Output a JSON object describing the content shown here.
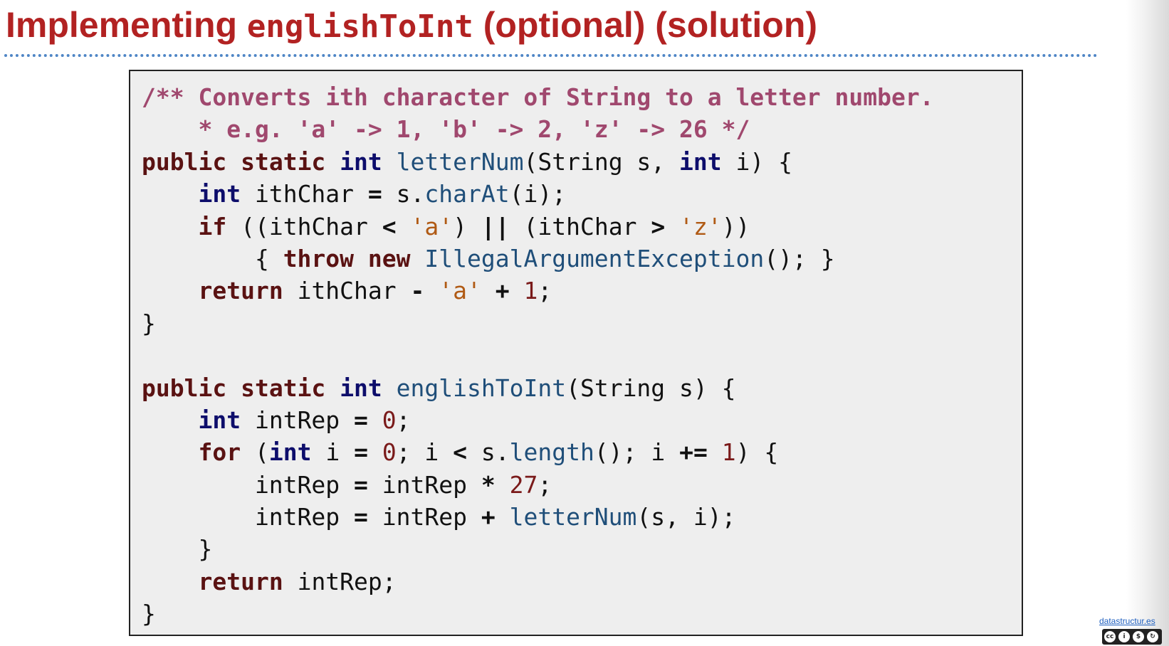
{
  "slide": {
    "title_prefix": "Implementing ",
    "title_code": "englishToInt",
    "title_suffix": " (optional) (solution)"
  },
  "code": {
    "lines": [
      [
        {
          "t": "/** Converts ith character of String to a letter number.",
          "c": "cm"
        }
      ],
      [
        {
          "t": "    * e.g. 'a' -> 1, 'b' -> 2, 'z' -> 26 */",
          "c": "cm"
        }
      ],
      [
        {
          "t": "public",
          "c": "kw"
        },
        {
          "t": " "
        },
        {
          "t": "static",
          "c": "kw"
        },
        {
          "t": " "
        },
        {
          "t": "int",
          "c": "ty"
        },
        {
          "t": " "
        },
        {
          "t": "letterNum",
          "c": "fn"
        },
        {
          "t": "(String s, "
        },
        {
          "t": "int",
          "c": "ty"
        },
        {
          "t": " i) {"
        }
      ],
      [
        {
          "t": "    "
        },
        {
          "t": "int",
          "c": "ty"
        },
        {
          "t": " ithChar "
        },
        {
          "t": "=",
          "c": "op"
        },
        {
          "t": " s."
        },
        {
          "t": "charAt",
          "c": "fn"
        },
        {
          "t": "(i);"
        }
      ],
      [
        {
          "t": "    "
        },
        {
          "t": "if",
          "c": "kw"
        },
        {
          "t": " ((ithChar "
        },
        {
          "t": "<",
          "c": "op"
        },
        {
          "t": " "
        },
        {
          "t": "'a'",
          "c": "st"
        },
        {
          "t": ") "
        },
        {
          "t": "||",
          "c": "op"
        },
        {
          "t": " (ithChar "
        },
        {
          "t": ">",
          "c": "op"
        },
        {
          "t": " "
        },
        {
          "t": "'z'",
          "c": "st"
        },
        {
          "t": "))"
        }
      ],
      [
        {
          "t": "        { "
        },
        {
          "t": "throw",
          "c": "kw"
        },
        {
          "t": " "
        },
        {
          "t": "new",
          "c": "kw"
        },
        {
          "t": " "
        },
        {
          "t": "IllegalArgumentException",
          "c": "fn"
        },
        {
          "t": "(); }"
        }
      ],
      [
        {
          "t": "    "
        },
        {
          "t": "return",
          "c": "kw"
        },
        {
          "t": " ithChar "
        },
        {
          "t": "-",
          "c": "op"
        },
        {
          "t": " "
        },
        {
          "t": "'a'",
          "c": "st"
        },
        {
          "t": " "
        },
        {
          "t": "+",
          "c": "op"
        },
        {
          "t": " "
        },
        {
          "t": "1",
          "c": "nu"
        },
        {
          "t": ";"
        }
      ],
      [
        {
          "t": "}"
        }
      ],
      [
        {
          "t": ""
        }
      ],
      [
        {
          "t": "public",
          "c": "kw"
        },
        {
          "t": " "
        },
        {
          "t": "static",
          "c": "kw"
        },
        {
          "t": " "
        },
        {
          "t": "int",
          "c": "ty"
        },
        {
          "t": " "
        },
        {
          "t": "englishToInt",
          "c": "fn"
        },
        {
          "t": "(String s) {"
        }
      ],
      [
        {
          "t": "    "
        },
        {
          "t": "int",
          "c": "ty"
        },
        {
          "t": " intRep "
        },
        {
          "t": "=",
          "c": "op"
        },
        {
          "t": " "
        },
        {
          "t": "0",
          "c": "nu"
        },
        {
          "t": ";"
        }
      ],
      [
        {
          "t": "    "
        },
        {
          "t": "for",
          "c": "kw"
        },
        {
          "t": " ("
        },
        {
          "t": "int",
          "c": "ty"
        },
        {
          "t": " i "
        },
        {
          "t": "=",
          "c": "op"
        },
        {
          "t": " "
        },
        {
          "t": "0",
          "c": "nu"
        },
        {
          "t": "; i "
        },
        {
          "t": "<",
          "c": "op"
        },
        {
          "t": " s."
        },
        {
          "t": "length",
          "c": "fn"
        },
        {
          "t": "(); i "
        },
        {
          "t": "+=",
          "c": "op"
        },
        {
          "t": " "
        },
        {
          "t": "1",
          "c": "nu"
        },
        {
          "t": ") {"
        }
      ],
      [
        {
          "t": "        intRep "
        },
        {
          "t": "=",
          "c": "op"
        },
        {
          "t": " intRep "
        },
        {
          "t": "*",
          "c": "op"
        },
        {
          "t": " "
        },
        {
          "t": "27",
          "c": "nu"
        },
        {
          "t": ";"
        }
      ],
      [
        {
          "t": "        intRep "
        },
        {
          "t": "=",
          "c": "op"
        },
        {
          "t": " intRep "
        },
        {
          "t": "+",
          "c": "op"
        },
        {
          "t": " "
        },
        {
          "t": "letterNum",
          "c": "fn"
        },
        {
          "t": "(s, i);"
        }
      ],
      [
        {
          "t": "    }"
        }
      ],
      [
        {
          "t": "    "
        },
        {
          "t": "return",
          "c": "kw"
        },
        {
          "t": " intRep;"
        }
      ],
      [
        {
          "t": "}"
        }
      ]
    ]
  },
  "footer": {
    "credit_text": "datastructur.es",
    "license_badge": [
      "cc-icon",
      "by-icon",
      "nc-icon",
      "sa-icon"
    ]
  }
}
